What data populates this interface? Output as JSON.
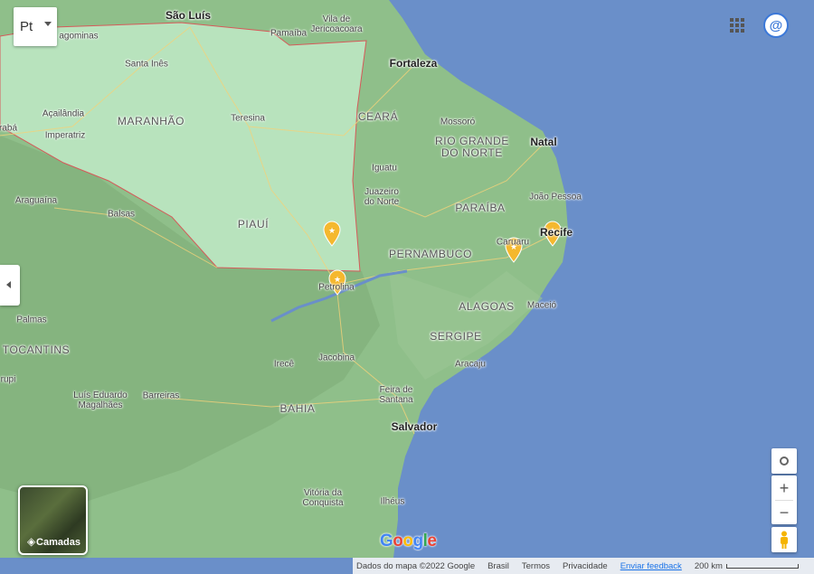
{
  "map": {
    "states": [
      "MARANHÃO",
      "PIAUÍ",
      "CEARÁ",
      "RIO GRANDE\nDO NORTE",
      "PARAÍBA",
      "PERNAMBUCO",
      "ALAGOAS",
      "SERGIPE",
      "BAHIA",
      "TOCANTINS"
    ],
    "capitals": [
      "São Luís",
      "Fortaleza",
      "Natal",
      "Recife",
      "Salvador",
      "Teresina"
    ],
    "cities": [
      "Pamaíba",
      "Vila de\nJericoacoara",
      "Santa Inês",
      "Açailândia",
      "Imperatriz",
      "Mossoró",
      "Iguatu",
      "Juazeiro\ndo Norte",
      "João Pessoa",
      "Caruaru",
      "Maceió",
      "Aracaju",
      "Petrolina",
      "Jacobina",
      "Feira de\nSantana",
      "Irecê",
      "Barreiras",
      "Luís Eduardo\nMagalhães",
      "Vitória da\nConquista",
      "Ilhéus",
      "Balsas",
      "Araguaína",
      "Palmas",
      "agominas",
      "rabá",
      "rupi"
    ],
    "marker_count": 4,
    "highlighted_states": [
      "MARANHÃO",
      "PIAUÍ"
    ]
  },
  "controls": {
    "language_button": "Pt",
    "layers_label": "Camadas",
    "zoom_in": "+",
    "zoom_out": "−",
    "apps_icon": "apps-grid-icon",
    "account_icon": "account-avatar-icon"
  },
  "footer": {
    "data_credit": "Dados do mapa ©2022 Google",
    "country": "Brasil",
    "terms": "Termos",
    "privacy": "Privacidade",
    "feedback": "Enviar feedback",
    "scale": "200 km"
  },
  "brand": {
    "logo": "Google"
  },
  "colors": {
    "ocean": "#6a8fc9",
    "land": "#8fbf8a",
    "highlight": "#b8e3bd",
    "border": "#d65a5a",
    "marker": "#f5b82e"
  }
}
